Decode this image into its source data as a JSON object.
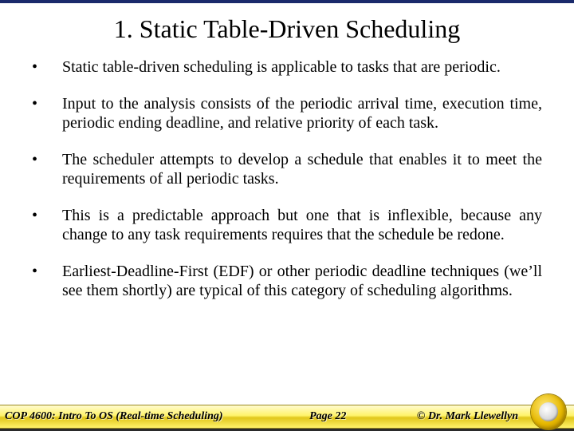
{
  "title": "1. Static Table-Driven Scheduling",
  "bullets": [
    "Static table-driven scheduling is applicable to tasks that are periodic.",
    "Input to the analysis consists of the periodic arrival time, execution time, periodic ending deadline, and relative priority of each task.",
    "The scheduler attempts to develop a schedule that enables it to meet the requirements of all periodic tasks.",
    "This is a predictable approach but one that is inflexible, because any change to any task requirements requires that the schedule be redone.",
    "Earliest-Deadline-First (EDF) or other periodic deadline techniques (we’ll see them shortly) are typical of this category of scheduling algorithms."
  ],
  "footer": {
    "course": "COP 4600: Intro To OS  (Real-time Scheduling)",
    "page": "Page  22",
    "author": "© Dr. Mark Llewellyn"
  }
}
